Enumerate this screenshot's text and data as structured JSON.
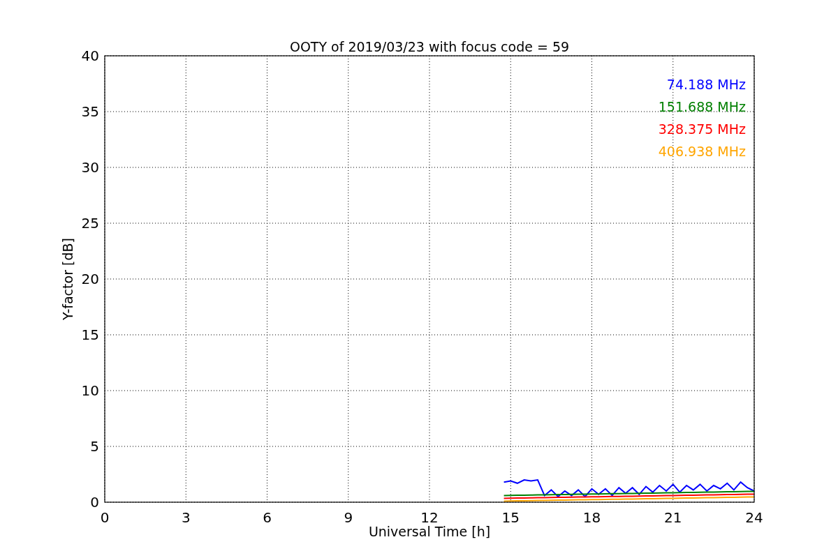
{
  "figure": {
    "chart_data": {
      "type": "line",
      "title": "OOTY of 2019/03/23 with focus code = 59",
      "xlabel": "Universal Time [h]",
      "ylabel": "Y-factor [dB]",
      "x": [
        14.75,
        15,
        15.25,
        15.5,
        15.75,
        16,
        16.25,
        16.5,
        16.75,
        17,
        17.25,
        17.5,
        17.75,
        18,
        18.25,
        18.5,
        18.75,
        19,
        19.25,
        19.5,
        19.75,
        20,
        20.25,
        20.5,
        20.75,
        21,
        21.25,
        21.5,
        21.75,
        22,
        22.25,
        22.5,
        22.75,
        23,
        23.25,
        23.5,
        23.75,
        24
      ],
      "series": [
        {
          "name": "74.188 MHz",
          "color": "#0000ff",
          "values": [
            1.8,
            1.9,
            1.7,
            2.0,
            1.9,
            2.0,
            0.6,
            1.1,
            0.5,
            1.0,
            0.6,
            1.1,
            0.5,
            1.2,
            0.7,
            1.2,
            0.6,
            1.3,
            0.8,
            1.3,
            0.7,
            1.4,
            0.9,
            1.5,
            1.0,
            1.6,
            0.9,
            1.5,
            1.1,
            1.6,
            1.0,
            1.5,
            1.2,
            1.7,
            1.1,
            1.8,
            1.3,
            1.0
          ]
        },
        {
          "name": "151.688 MHz",
          "color": "#008000",
          "values": [
            0.6,
            0.61,
            0.62,
            0.63,
            0.64,
            0.65,
            0.66,
            0.67,
            0.68,
            0.69,
            0.7,
            0.71,
            0.72,
            0.73,
            0.74,
            0.75,
            0.76,
            0.77,
            0.78,
            0.79,
            0.8,
            0.81,
            0.82,
            0.83,
            0.84,
            0.85,
            0.86,
            0.87,
            0.88,
            0.89,
            0.9,
            0.91,
            0.92,
            0.93,
            0.94,
            0.95,
            0.96,
            0.97
          ]
        },
        {
          "name": "328.375 MHz",
          "color": "#ff0000",
          "values": [
            0.35,
            0.36,
            0.37,
            0.38,
            0.39,
            0.4,
            0.41,
            0.42,
            0.43,
            0.44,
            0.45,
            0.46,
            0.47,
            0.48,
            0.49,
            0.5,
            0.51,
            0.52,
            0.53,
            0.54,
            0.55,
            0.56,
            0.57,
            0.58,
            0.59,
            0.6,
            0.61,
            0.62,
            0.63,
            0.64,
            0.65,
            0.66,
            0.67,
            0.68,
            0.69,
            0.7,
            0.71,
            0.72
          ]
        },
        {
          "name": "406.938 MHz",
          "color": "#ffa500",
          "values": [
            0.1,
            0.11,
            0.12,
            0.13,
            0.14,
            0.15,
            0.16,
            0.17,
            0.18,
            0.19,
            0.2,
            0.21,
            0.22,
            0.23,
            0.24,
            0.25,
            0.26,
            0.27,
            0.28,
            0.29,
            0.3,
            0.31,
            0.32,
            0.33,
            0.34,
            0.35,
            0.36,
            0.37,
            0.38,
            0.39,
            0.4,
            0.41,
            0.42,
            0.43,
            0.44,
            0.45,
            0.46,
            0.47
          ]
        }
      ],
      "grid": true,
      "xlim": [
        0,
        24
      ],
      "ylim": [
        0,
        40
      ],
      "xticks": [
        0,
        3,
        6,
        9,
        12,
        15,
        18,
        21,
        24
      ],
      "yticks": [
        0,
        5,
        10,
        15,
        20,
        25,
        30,
        35,
        40
      ]
    }
  }
}
